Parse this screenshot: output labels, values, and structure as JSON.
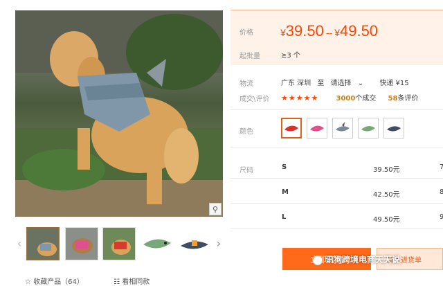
{
  "price": {
    "label": "价格",
    "currency": "¥",
    "low": "39.50",
    "separator": "--",
    "high": "49.50",
    "moq_label": "起批量",
    "moq_value": "≥3 个"
  },
  "logistics": {
    "label": "物流",
    "from": "广东 深圳",
    "to_word": "至",
    "destination": "请选择",
    "method": "快递 ¥15"
  },
  "deals": {
    "label": "成交\\评价",
    "stars": "★★★★★",
    "count": "3000",
    "count_suffix": "个成交",
    "reviews": "58",
    "reviews_suffix": "条评价"
  },
  "colors": {
    "label": "颜色",
    "options": [
      "red",
      "pink",
      "gray-shark",
      "green-fish",
      "navy"
    ]
  },
  "sizes": {
    "label": "尺码",
    "rows": [
      {
        "size": "S",
        "price": "39.50元",
        "stock": "7"
      },
      {
        "size": "M",
        "price": "42.50元",
        "stock": "8"
      },
      {
        "size": "L",
        "price": "49.50元",
        "stock": "9"
      }
    ]
  },
  "actions": {
    "buy_label": "立即订购",
    "cart_label": "加入进货单"
  },
  "watermark": "讯狗跨境电商天天说",
  "bottom": {
    "fav": "☆ 收藏产品（64）",
    "more": "☷ 看相同款"
  }
}
